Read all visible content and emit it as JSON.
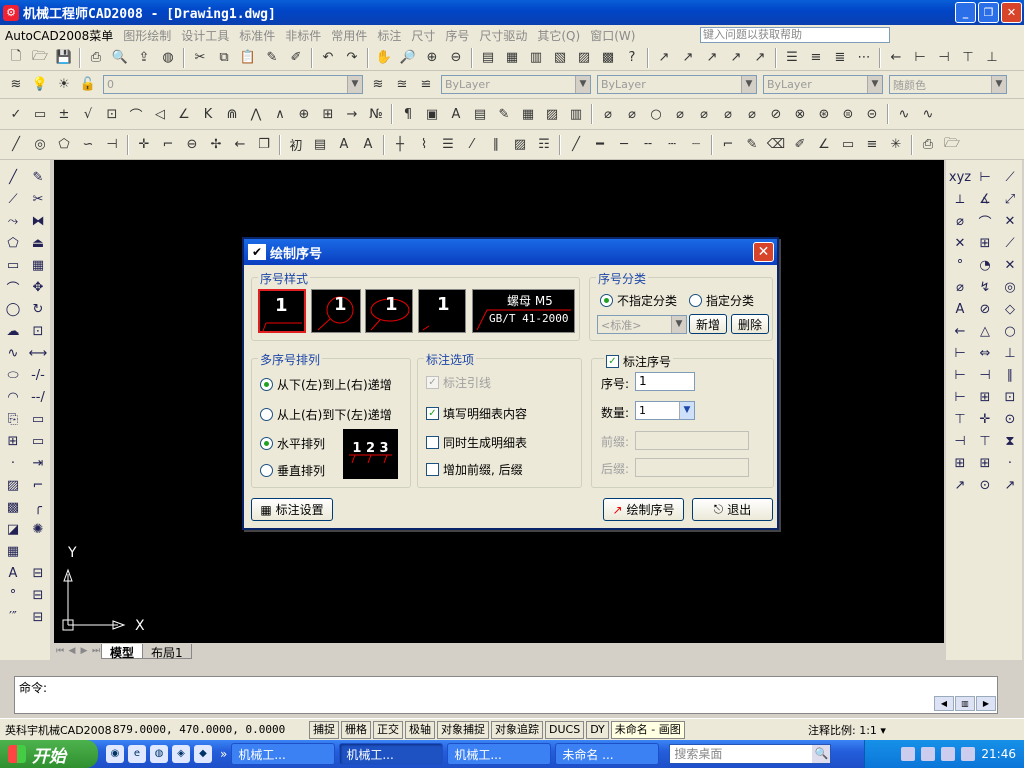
{
  "window": {
    "title": "机械工程师CAD2008 - [Drawing1.dwg]"
  },
  "menubar": {
    "items": [
      "AutoCAD2008菜单",
      "图形绘制",
      "设计工具",
      "标准件",
      "非标件",
      "常用件",
      "标注",
      "尺寸",
      "序号",
      "尺寸驱动",
      "其它(Q)",
      "窗口(W)"
    ],
    "help_placeholder": "键入问题以获取帮助"
  },
  "toolbars": {
    "layer_value": "0",
    "color_value": "ByLayer",
    "linetype_value": "ByLayer",
    "lineweight_value": "ByLayer",
    "plotstyle_value": "随颜色"
  },
  "canvas": {
    "axis_x": "X",
    "axis_y": "Y",
    "tabs": [
      "模型",
      "布局1"
    ]
  },
  "command": {
    "prompt": "命令:"
  },
  "status": {
    "product": "英科宇机械CAD2008",
    "coords": "879.0000, 470.0000, 0.0000",
    "buttons": [
      "捕捉",
      "栅格",
      "正交",
      "极轴",
      "对象捕捉",
      "对象追踪",
      "DUCS",
      "DY"
    ],
    "tooltip": "未命名 - 画图",
    "scale_label": "注释比例:",
    "scale_value": "1:1"
  },
  "taskbar": {
    "start": "开始",
    "tasks": [
      "机械工...",
      "机械工...",
      "机械工...",
      "未命名 ..."
    ],
    "search_placeholder": "搜索桌面",
    "clock": "21:46"
  },
  "dialog": {
    "title": "绘制序号",
    "style_group": "序号样式",
    "style_tiles": [
      "1",
      "1",
      "1",
      "1"
    ],
    "style_tile_text_line1": "螺母 M5",
    "style_tile_text_line2": "GB/T 41-2000",
    "category_group": "序号分类",
    "category_opt1": "不指定分类",
    "category_opt2": "指定分类",
    "category_select": "<标准>",
    "btn_add": "新增",
    "btn_delete": "删除",
    "arrange_group": "多序号排列",
    "arrange_opt1": "从下(左)到上(右)递增",
    "arrange_opt2": "从上(右)到下(左)递增",
    "arrange_opt3": "水平排列",
    "arrange_opt4": "垂直排列",
    "preview_text": "1 2 3",
    "mark_group": "标注选项",
    "mark_opt1": "标注引线",
    "mark_opt2": "填写明细表内容",
    "mark_opt3": "同时生成明细表",
    "mark_opt4": "增加前缀, 后缀",
    "number_group": "标注序号",
    "field_seq_label": "序号:",
    "field_seq_value": "1",
    "field_qty_label": "数量:",
    "field_qty_value": "1",
    "field_prefix_label": "前缀:",
    "field_suffix_label": "后缀:",
    "btn_settings": "标注设置",
    "btn_draw": "绘制序号",
    "btn_exit": "退出"
  }
}
